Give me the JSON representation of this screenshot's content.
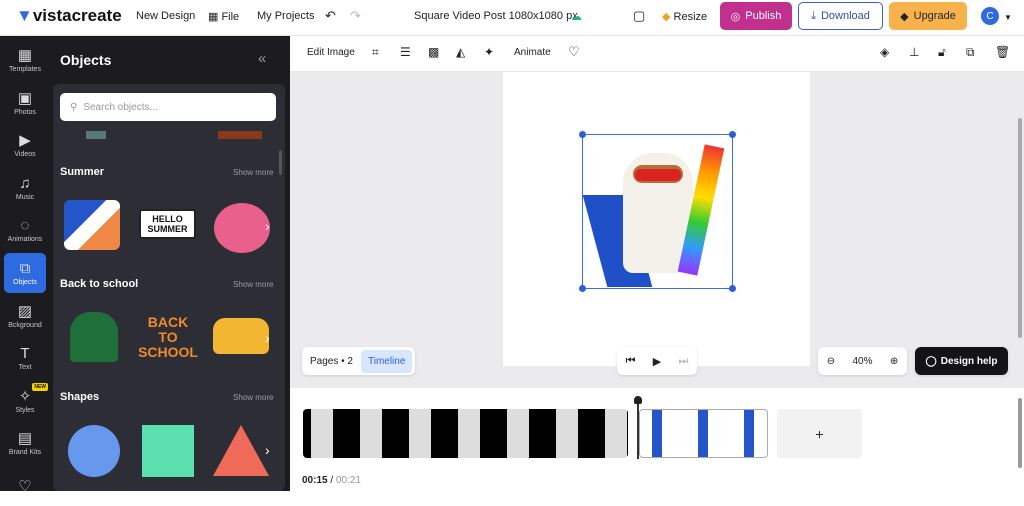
{
  "topbar": {
    "logo": "vistacreate",
    "new_design": "New Design",
    "file": "File",
    "my_projects": "My Projects",
    "doc_title": "Square Video Post 1080x1080 px",
    "resize": "Resize",
    "publish": "Publish",
    "download": "Download",
    "upgrade": "Upgrade",
    "avatar": "C"
  },
  "colors": {
    "publish": "#c2308f",
    "download_border": "#3a63c9",
    "upgrade": "#f7b24c",
    "active": "#2f6be0",
    "rail": "#1c1c20",
    "panel": "#2d2d35"
  },
  "rail": [
    {
      "label": "Templates",
      "icon": "▦"
    },
    {
      "label": "Photos",
      "icon": "▣"
    },
    {
      "label": "Videos",
      "icon": "▶"
    },
    {
      "label": "Music",
      "icon": "♫"
    },
    {
      "label": "Animations",
      "icon": "◌"
    },
    {
      "label": "Objects",
      "icon": "⧉"
    },
    {
      "label": "Bckground",
      "icon": "▨"
    },
    {
      "label": "Text",
      "icon": "T"
    },
    {
      "label": "Styles",
      "icon": "✧",
      "badge": "NEW"
    },
    {
      "label": "Brand Kits",
      "icon": "▤"
    },
    {
      "label": "",
      "icon": "♡"
    }
  ],
  "panel": {
    "title": "Objects",
    "search_placeholder": "Search objects...",
    "sections": [
      {
        "title": "Summer",
        "more": "Show more",
        "items": [
          "",
          "HELLO SUMMER",
          ""
        ]
      },
      {
        "title": "Back to school",
        "more": "Show more",
        "items": [
          "",
          "BACK TO SCHOOL",
          ""
        ]
      },
      {
        "title": "Shapes",
        "more": "Show more",
        "items": [
          "circle",
          "square",
          "triangle"
        ]
      }
    ]
  },
  "toolbar": {
    "edit_image": "Edit Image",
    "animate": "Animate"
  },
  "bottom": {
    "pages": "Pages • 2",
    "timeline": "Timeline",
    "zoom": "40%",
    "design_help": "Design help"
  },
  "timeline": {
    "current": "00:15",
    "sep": "/",
    "total": "00:21",
    "add": "+"
  }
}
